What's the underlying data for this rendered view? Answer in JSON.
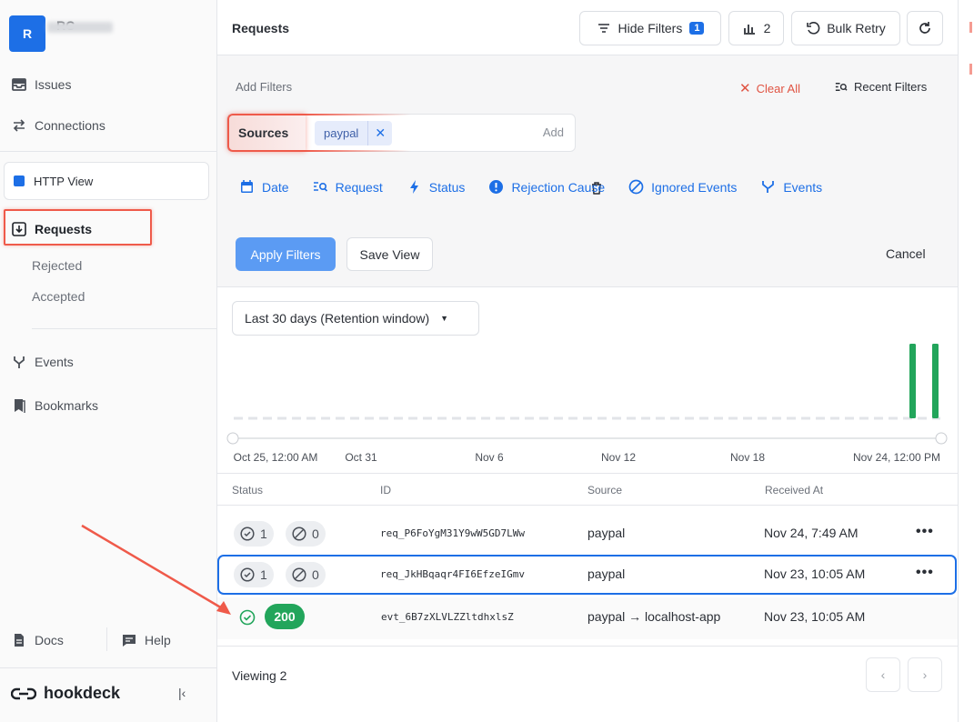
{
  "account": {
    "initial": "R",
    "name": "RC"
  },
  "sidebar": {
    "items": [
      {
        "label": "Issues",
        "icon": "inbox-icon"
      },
      {
        "label": "Connections",
        "icon": "arrows-icon"
      }
    ],
    "http_view": "HTTP View",
    "requests": "Requests",
    "sub": [
      "Rejected",
      "Accepted"
    ],
    "items2": [
      {
        "label": "Events",
        "icon": "fork-icon"
      },
      {
        "label": "Bookmarks",
        "icon": "bookmark-icon"
      }
    ],
    "docs": "Docs",
    "help": "Help",
    "logo": "hookdeck"
  },
  "header": {
    "title": "Requests",
    "hide_filters": "Hide Filters",
    "filter_count": "1",
    "chart_count": "2",
    "bulk_retry": "Bulk Retry"
  },
  "filters": {
    "add_filters": "Add Filters",
    "clear_all": "Clear All",
    "recent": "Recent Filters",
    "source_label": "Sources",
    "source_chip": "paypal",
    "add": "Add",
    "tabs": [
      "Date",
      "Request",
      "Status",
      "Rejection Cause",
      "Ignored Events",
      "Events"
    ],
    "apply": "Apply Filters",
    "save": "Save View",
    "cancel": "Cancel"
  },
  "range": {
    "label": "Last 30 days (Retention window)"
  },
  "chart_data": {
    "type": "bar",
    "x_ticks": [
      "Oct 25, 12:00 AM",
      "Oct 31",
      "Nov 6",
      "Nov 12",
      "Nov 18",
      "Nov 24, 12:00 PM"
    ],
    "bar_color": "#22a55b"
  },
  "table": {
    "headers": [
      "Status",
      "ID",
      "Source",
      "Received At"
    ],
    "rows": [
      {
        "ok": "1",
        "ignored": "0",
        "id": "req_P6FoYgM31Y9wW5GD7LWw",
        "source": "paypal",
        "time": "Nov 24, 7:49 AM"
      },
      {
        "ok": "1",
        "ignored": "0",
        "id": "req_JkHBqaqr4FI6EfzeIGmv",
        "source": "paypal",
        "time": "Nov 23, 10:05 AM"
      }
    ],
    "event": {
      "code": "200",
      "id": "evt_6B7zXLVLZZltdhxlsZ",
      "source": "paypal → localhost-app",
      "time": "Nov 23, 10:05 AM"
    }
  },
  "footer": {
    "viewing": "Viewing 2"
  },
  "colors": {
    "accent": "#1d6fe6",
    "success": "#22a55b",
    "highlight": "#ef5a4a"
  }
}
